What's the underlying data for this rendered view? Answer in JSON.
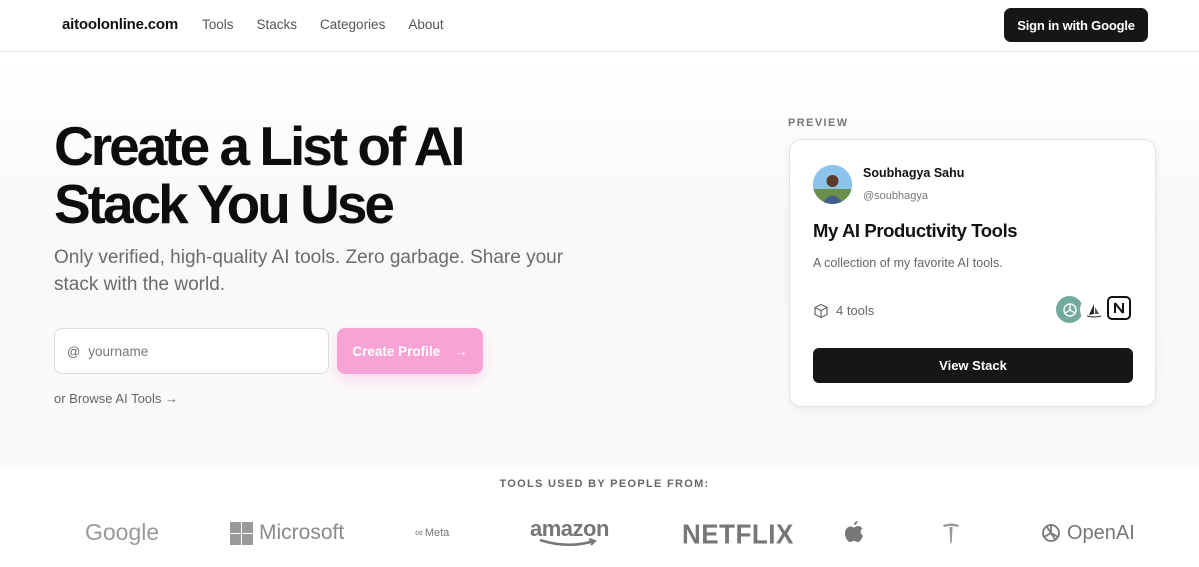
{
  "header": {
    "brand": "aitoolonline.com",
    "nav": [
      "Tools",
      "Stacks",
      "Categories",
      "About"
    ],
    "signin_label": "Sign in with Google"
  },
  "hero": {
    "headline_line1": "Create a List of AI",
    "headline_line2": "Stack You Use",
    "subtext": "Only verified, high-quality AI tools. Zero garbage. Share your stack with the world.",
    "input_prefix": "@",
    "input_placeholder": "yourname",
    "input_value": "",
    "create_label": "Create Profile",
    "create_arrow": "→",
    "browse_link": "or Browse AI Tools →"
  },
  "preview": {
    "label": "PREVIEW",
    "user_name": "Soubhagya Sahu",
    "user_handle": "@soubhagya",
    "title": "My AI Productivity Tools",
    "description": "A collection of my favorite AI tools.",
    "tool_count": "4 tools",
    "tool_icons": [
      "openai-icon",
      "midjourney-icon",
      "notion-icon"
    ],
    "view_label": "View Stack"
  },
  "logos": {
    "label": "TOOLS USED BY PEOPLE FROM:",
    "google": "Google",
    "microsoft": "Microsoft",
    "meta": "Meta",
    "amazon": "amazon",
    "netflix": "NETFLIX",
    "apple_icon": "apple-logo-icon",
    "tesla_icon": "tesla-logo-icon",
    "openai": "OpenAI"
  },
  "colors": {
    "accent_pink": "#f7a3d5",
    "dark_button": "#161616"
  }
}
